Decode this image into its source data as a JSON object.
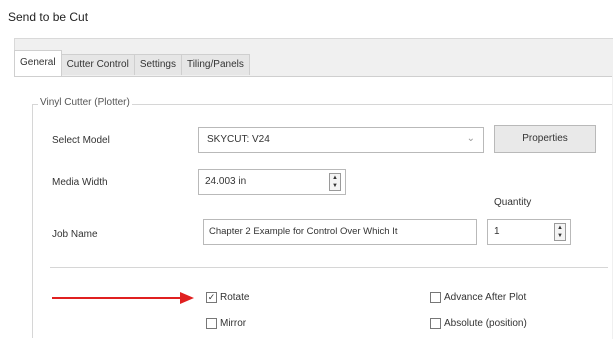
{
  "window": {
    "title": "Send to be Cut"
  },
  "tabs": [
    {
      "label": "General",
      "active": true
    },
    {
      "label": "Cutter Control",
      "active": false
    },
    {
      "label": "Settings",
      "active": false
    },
    {
      "label": "Tiling/Panels",
      "active": false
    }
  ],
  "group": {
    "label": "Vinyl Cutter (Plotter)"
  },
  "fields": {
    "select_model": {
      "label": "Select Model",
      "value": "SKYCUT: V24"
    },
    "properties_label": "Properties",
    "media_width": {
      "label": "Media Width",
      "value": "24.003 in"
    },
    "quantity": {
      "label": "Quantity",
      "value": "1"
    },
    "job_name": {
      "label": "Job Name",
      "value": "Chapter 2 Example for Control Over Which It"
    }
  },
  "checkboxes": [
    {
      "label": "Rotate",
      "checked": true
    },
    {
      "label": "Mirror",
      "checked": false
    },
    {
      "label": "Advance After Plot",
      "checked": false
    },
    {
      "label": "Absolute (position)",
      "checked": false
    }
  ],
  "annotation": {
    "arrow_color": "#e02020"
  }
}
